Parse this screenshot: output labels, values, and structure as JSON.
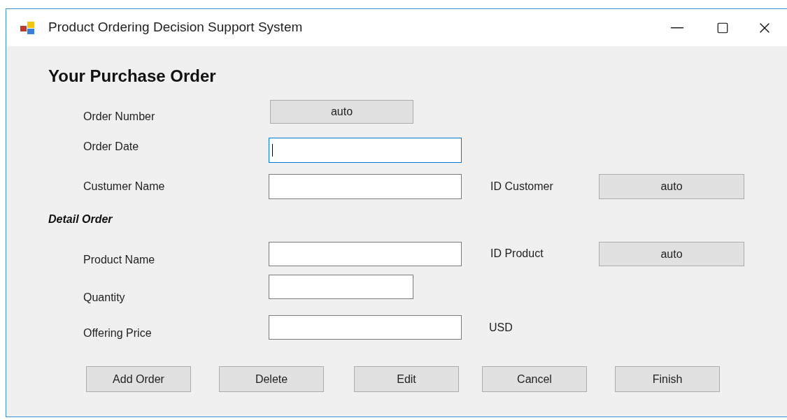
{
  "window": {
    "title": "Product Ordering Decision Support System"
  },
  "heading": "Your Purchase Order",
  "order_number": {
    "label": "Order Number",
    "value": "auto"
  },
  "order_date": {
    "label": "Order Date",
    "focused": true
  },
  "customer_name": {
    "label": "Custumer Name",
    "focused": false
  },
  "id_customer": {
    "label": "ID Customer",
    "value": "auto"
  },
  "detail_heading": "Detail Order",
  "product_name": {
    "label": "Product Name",
    "focused": false
  },
  "id_product": {
    "label": "ID Product",
    "value": "auto"
  },
  "quantity": {
    "label": "Quantity",
    "focused": false
  },
  "offering_price": {
    "label": "Offering Price",
    "focused": false
  },
  "currency": "USD",
  "buttons": [
    "Add Order",
    "Delete",
    "Edit",
    "Cancel",
    "Finish"
  ]
}
